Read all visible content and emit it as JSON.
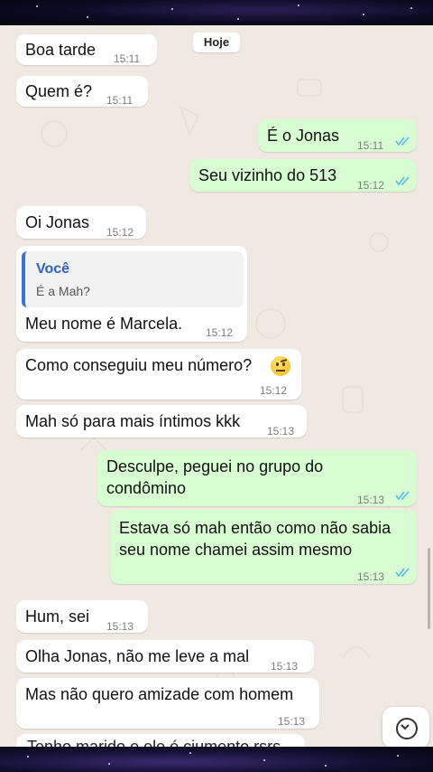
{
  "date_divider": "Hoje",
  "messages": [
    {
      "text": "Boa tarde",
      "time": "15:11"
    },
    {
      "text": "Quem é?",
      "time": "15:11"
    },
    {
      "text": "É o Jonas",
      "time": "15:11"
    },
    {
      "text": "Seu vizinho do 513",
      "time": "15:12"
    },
    {
      "text": "Oi Jonas",
      "time": "15:12"
    },
    {
      "reply_name": "Você",
      "reply_text": "É a Mah?",
      "text": "Meu nome é Marcela.",
      "time": "15:12"
    },
    {
      "text": "Como conseguiu meu número?",
      "time": "15:12"
    },
    {
      "text": "Mah só para mais íntimos kkk",
      "time": "15:13"
    },
    {
      "text_line1": "Desculpe, peguei no grupo do",
      "text_line2": "condômino",
      "time": "15:13"
    },
    {
      "text_line1": "Estava só mah então como não sabia",
      "text_line2": "seu nome chamei assim mesmo",
      "time": "15:13"
    },
    {
      "text": "Hum, sei",
      "time": "15:13"
    },
    {
      "text": "Olha Jonas, não me leve a mal",
      "time": "15:13"
    },
    {
      "text": "Mas não quero amizade com homem",
      "time": "15:13"
    }
  ],
  "partial_message": "Tenho marido e ele é ciumento rsrs",
  "colors": {
    "outgoing": "#d9fdd3",
    "incoming": "#ffffff",
    "read_ticks": "#53bdeb",
    "background": "#efe9e1"
  },
  "icons": {
    "scroll_down": "chevron-down-circle-icon",
    "read_receipt": "double-check-icon",
    "emoji": "raised-eyebrow-emoji"
  }
}
